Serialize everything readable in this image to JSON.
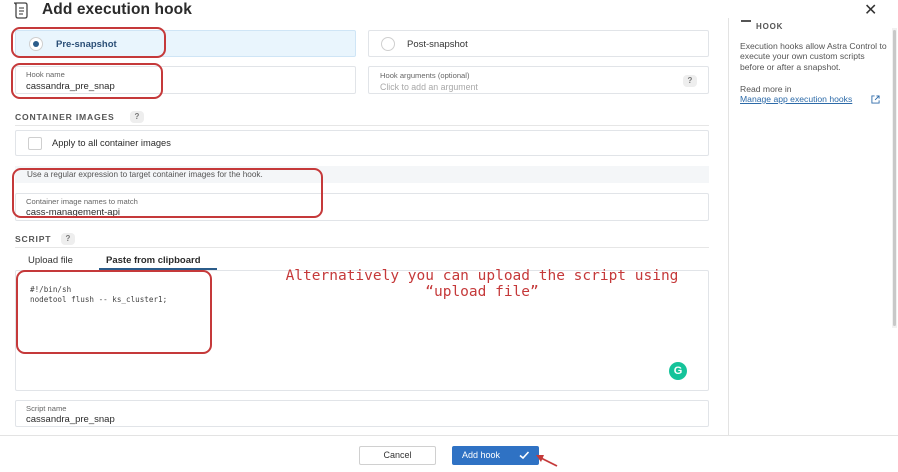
{
  "header": {
    "title": "Add execution hook",
    "close_glyph": "✕",
    "icon": "scroll-icon"
  },
  "side_panel": {
    "title": "HOOK",
    "description": "Execution hooks allow Astra Control to execute your own custom scripts before or after a snapshot.",
    "learn_more": "Read more in",
    "link": "Manage app execution hooks",
    "link_icon": "external-link-icon"
  },
  "stage": {
    "options": [
      {
        "label": "Pre-snapshot",
        "selected": true
      },
      {
        "label": "Post-snapshot",
        "selected": false
      }
    ]
  },
  "hook_name": {
    "label": "Hook name",
    "value": "cassandra_pre_snap"
  },
  "hook_args": {
    "label": "Hook arguments (optional)",
    "placeholder": "Click to add an argument",
    "help": "?"
  },
  "container_images": {
    "title": "CONTAINER IMAGES",
    "help": "?",
    "apply_all": "Apply to all container images",
    "regex_info": "Use a regular expression to target container images for the hook.",
    "match_label": "Container image names to match",
    "match_value": "cass-management-api"
  },
  "script": {
    "title": "SCRIPT",
    "help": "?",
    "tabs": [
      {
        "label": "Upload file",
        "active": false
      },
      {
        "label": "Paste from clipboard",
        "active": true
      }
    ],
    "code": "#!/bin/sh\nnodetool flush -- ks_cluster1;",
    "grammarly": "G"
  },
  "annotation": {
    "line1": "Alternatively you can upload the script using",
    "line2": "“upload file”"
  },
  "script_name": {
    "label": "Script name",
    "value": "cassandra_pre_snap"
  },
  "footer": {
    "cancel": "Cancel",
    "add": "Add hook"
  },
  "colors": {
    "accent": "#2f72c4",
    "selected_bg": "#e9f5fd",
    "annotation_red": "#c5393a",
    "grammarly_green": "#15c39a"
  }
}
